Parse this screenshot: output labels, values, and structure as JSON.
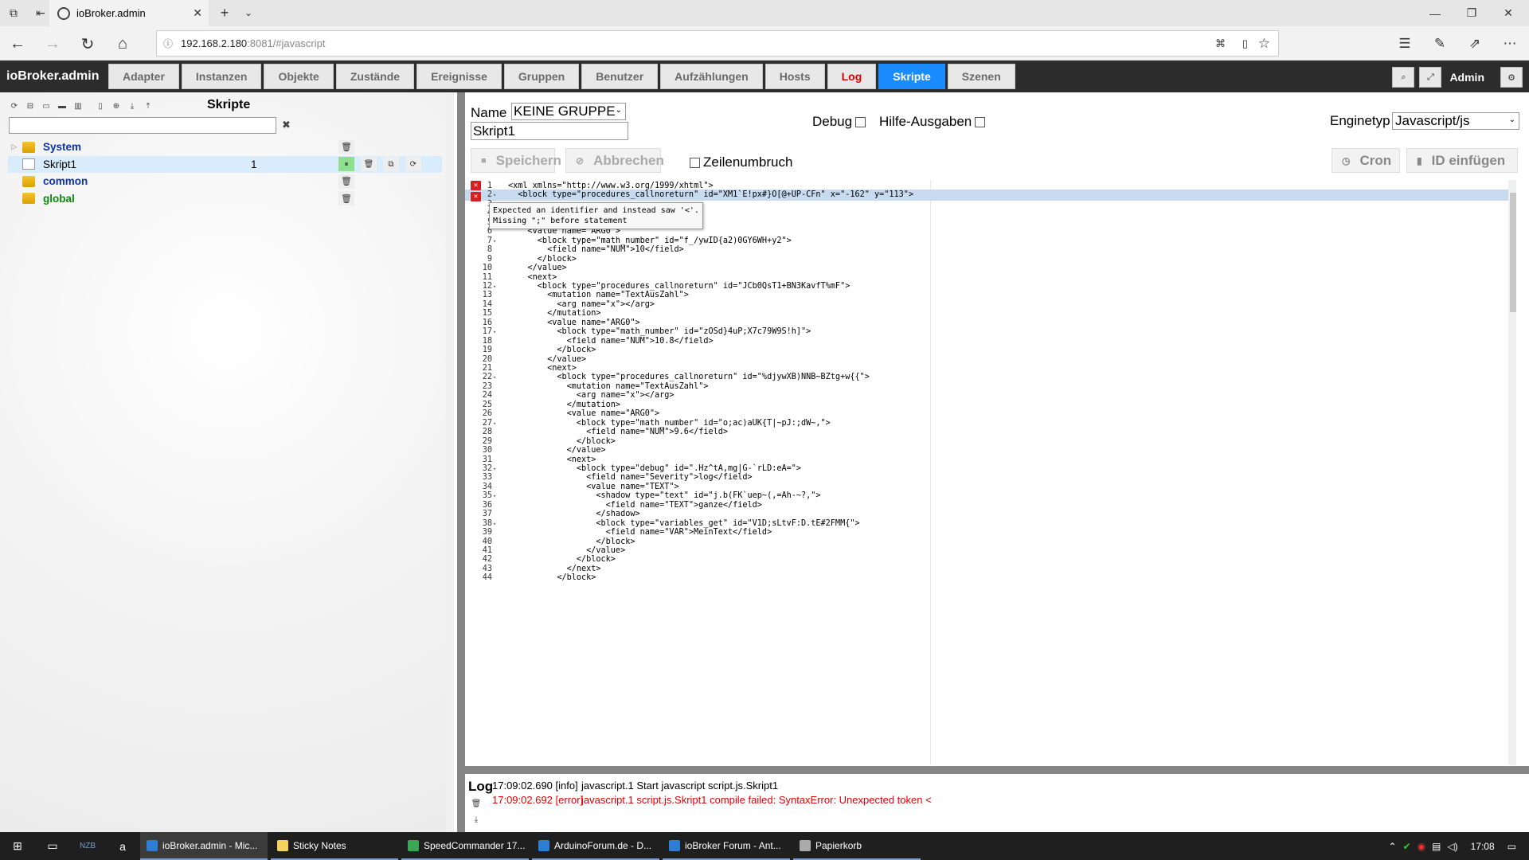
{
  "browser": {
    "tab_title": "ioBroker.admin",
    "url_host": "192.168.2.180",
    "url_path": ":8081/#javascript"
  },
  "navbar": {
    "app_name": "ioBroker.admin",
    "tabs": [
      {
        "label": "Adapter"
      },
      {
        "label": "Instanzen"
      },
      {
        "label": "Objekte"
      },
      {
        "label": "Zustände"
      },
      {
        "label": "Ereignisse"
      },
      {
        "label": "Gruppen"
      },
      {
        "label": "Benutzer"
      },
      {
        "label": "Aufzählungen"
      },
      {
        "label": "Hosts"
      },
      {
        "label": "Log"
      },
      {
        "label": "Skripte"
      },
      {
        "label": "Szenen"
      }
    ],
    "active_tab": "Skripte",
    "user": "Admin"
  },
  "scripts_panel": {
    "title": "Skripte",
    "search_value": "",
    "tree": [
      {
        "name": "System",
        "kind": "folder",
        "color": "blue"
      },
      {
        "name": "Skript1",
        "kind": "script",
        "count": "1"
      },
      {
        "name": "common",
        "kind": "folder",
        "color": "blue"
      },
      {
        "name": "global",
        "kind": "folder",
        "color": "green"
      }
    ]
  },
  "editor": {
    "name_label": "Name",
    "group": "KEINE GRUPPE",
    "script_name": "Skript1",
    "debug_label": "Debug",
    "help_label": "Hilfe-Ausgaben",
    "engine_label": "Enginetyp",
    "engine": "Javascript/js",
    "save_label": "Speichern",
    "cancel_label": "Abbrechen",
    "wrap_label": "Zeilenumbruch",
    "cron_label": "Cron",
    "insert_id_label": "ID einfügen",
    "error_tooltip_1": "Expected an identifier and instead saw '<'.",
    "error_tooltip_2": "Missing \";\" before statement",
    "lines": [
      {
        "n": "1",
        "text": "<xml xmlns=\"http://www.w3.org/1999/xhtml\">"
      },
      {
        "n": "2",
        "text": "  <block type=\"procedures_callnoreturn\" id=\"XM1`E!px#}O[@+UP-CFn\" x=\"-162\" y=\"113\">"
      },
      {
        "n": "3",
        "text": ""
      },
      {
        "n": "4",
        "text": ""
      },
      {
        "n": "5",
        "text": "    </mutation>"
      },
      {
        "n": "6",
        "text": "    <value name=\"ARG0\">"
      },
      {
        "n": "7",
        "text": "      <block type=\"math_number\" id=\"f_/ywID{a2)0GY6WH+y2\">"
      },
      {
        "n": "8",
        "text": "        <field name=\"NUM\">10</field>"
      },
      {
        "n": "9",
        "text": "      </block>"
      },
      {
        "n": "10",
        "text": "    </value>"
      },
      {
        "n": "11",
        "text": "    <next>"
      },
      {
        "n": "12",
        "text": "      <block type=\"procedures_callnoreturn\" id=\"JCb0QsT1+BN3KavfT%mF\">"
      },
      {
        "n": "13",
        "text": "        <mutation name=\"TextAusZahl\">"
      },
      {
        "n": "14",
        "text": "          <arg name=\"x\"></arg>"
      },
      {
        "n": "15",
        "text": "        </mutation>"
      },
      {
        "n": "16",
        "text": "        <value name=\"ARG0\">"
      },
      {
        "n": "17",
        "text": "          <block type=\"math_number\" id=\"zOSd}4uP;X7c79W9S!h]\">"
      },
      {
        "n": "18",
        "text": "            <field name=\"NUM\">10.8</field>"
      },
      {
        "n": "19",
        "text": "          </block>"
      },
      {
        "n": "20",
        "text": "        </value>"
      },
      {
        "n": "21",
        "text": "        <next>"
      },
      {
        "n": "22",
        "text": "          <block type=\"procedures_callnoreturn\" id=\"%djywXB)NNB~BZtg+w{{\">"
      },
      {
        "n": "23",
        "text": "            <mutation name=\"TextAusZahl\">"
      },
      {
        "n": "24",
        "text": "              <arg name=\"x\"></arg>"
      },
      {
        "n": "25",
        "text": "            </mutation>"
      },
      {
        "n": "26",
        "text": "            <value name=\"ARG0\">"
      },
      {
        "n": "27",
        "text": "              <block type=\"math_number\" id=\"o;ac)aUK{T|~pJ:;dW~,\">"
      },
      {
        "n": "28",
        "text": "                <field name=\"NUM\">9.6</field>"
      },
      {
        "n": "29",
        "text": "              </block>"
      },
      {
        "n": "30",
        "text": "            </value>"
      },
      {
        "n": "31",
        "text": "            <next>"
      },
      {
        "n": "32",
        "text": "              <block type=\"debug\" id=\".Hz^tA,mg|G-`rLD:eA=\">"
      },
      {
        "n": "33",
        "text": "                <field name=\"Severity\">log</field>"
      },
      {
        "n": "34",
        "text": "                <value name=\"TEXT\">"
      },
      {
        "n": "35",
        "text": "                  <shadow type=\"text\" id=\"j.b(FK`uep~(,=Ah-~?,\">"
      },
      {
        "n": "36",
        "text": "                    <field name=\"TEXT\">ganze</field>"
      },
      {
        "n": "37",
        "text": "                  </shadow>"
      },
      {
        "n": "38",
        "text": "                  <block type=\"variables_get\" id=\"V1D;sLtvF:D.tE#2FMM{\">"
      },
      {
        "n": "39",
        "text": "                    <field name=\"VAR\">MeinText</field>"
      },
      {
        "n": "40",
        "text": "                  </block>"
      },
      {
        "n": "41",
        "text": "                </value>"
      },
      {
        "n": "42",
        "text": "              </block>"
      },
      {
        "n": "43",
        "text": "            </next>"
      },
      {
        "n": "44",
        "text": "          </block>"
      }
    ]
  },
  "log": {
    "title": "Log",
    "entries": [
      {
        "time": "17:09:02.690 [info]",
        "message": "javascript.1 Start javascript script.js.Skript1",
        "level": "info"
      },
      {
        "time": "17:09:02.692 [error]",
        "message": "javascript.1 script.js.Skript1 compile failed: SyntaxError: Unexpected token <",
        "level": "error"
      }
    ]
  },
  "taskbar": {
    "apps": [
      {
        "label": "ioBroker.admin - Mic..."
      },
      {
        "label": "Sticky Notes"
      },
      {
        "label": "SpeedCommander 17..."
      },
      {
        "label": "ArduinoForum.de - D..."
      },
      {
        "label": "ioBroker Forum - Ant..."
      },
      {
        "label": "Papierkorb"
      }
    ],
    "clock": "17:08"
  }
}
